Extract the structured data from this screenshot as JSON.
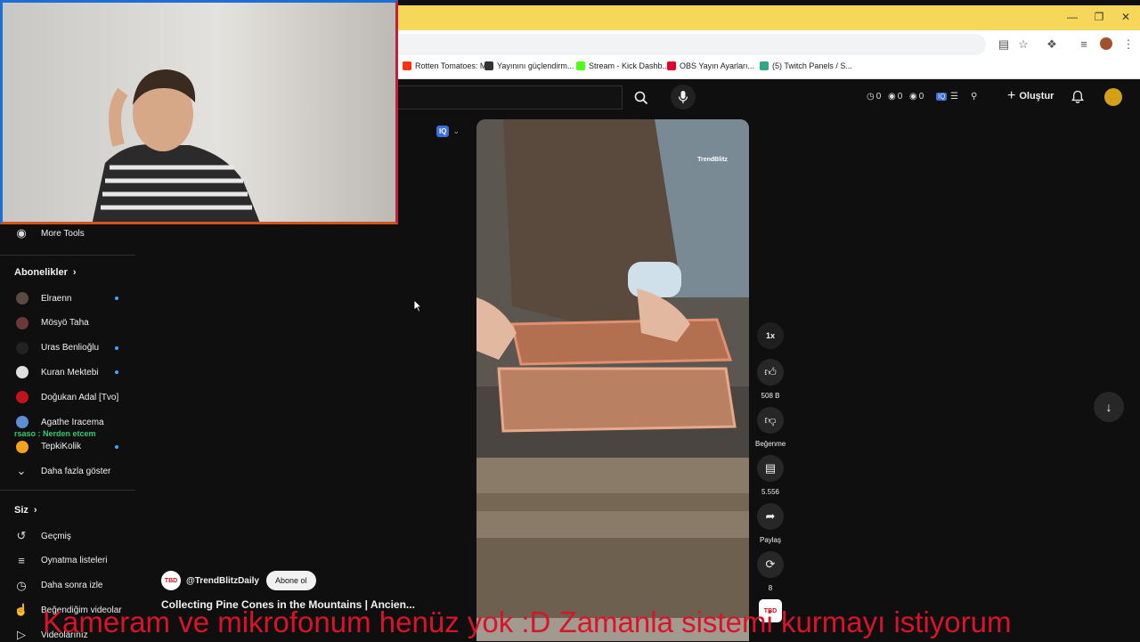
{
  "bookmarks": [
    {
      "label": "Rotten Tomatoes: M...",
      "color": "#fa320a"
    },
    {
      "label": "Yayınını güçlendirm...",
      "color": "#333333"
    },
    {
      "label": "Stream - Kick Dashb...",
      "color": "#53fc18"
    },
    {
      "label": "OBS Yayın Ayarları...",
      "color": "#e1002d"
    },
    {
      "label": "(5) Twitch Panels / S...",
      "color": "#2fa88a"
    }
  ],
  "header": {
    "ext_stats": [
      "0",
      "0",
      "0"
    ],
    "create_label": "Oluştur"
  },
  "sidebar": {
    "more_tools": "More Tools",
    "subscriptions_title": "Abonelikler",
    "channels": [
      {
        "name": "Elraenn",
        "color": "#5a4a40",
        "new": true
      },
      {
        "name": "Mösyö Taha",
        "color": "#6a3a3a",
        "new": false
      },
      {
        "name": "Uras Benlioğlu",
        "color": "#222222",
        "new": true
      },
      {
        "name": "Kuran Mektebi",
        "color": "#e0e0e0",
        "new": true
      },
      {
        "name": "Doğukan Adal [Tvo]",
        "color": "#c0141c",
        "new": false
      },
      {
        "name": "Agathe Iracema",
        "color": "#5a8fd6",
        "new": false
      },
      {
        "name": "TepkiKolik",
        "color": "#f2a31b",
        "new": true
      }
    ],
    "show_more": "Daha fazla göster",
    "you_title": "Siz",
    "you_items": [
      {
        "label": "Geçmiş",
        "icon": "history-icon"
      },
      {
        "label": "Oynatma listeleri",
        "icon": "playlist-icon"
      },
      {
        "label": "Daha sonra izle",
        "icon": "clock-icon"
      },
      {
        "label": "Beğendiğim videolar",
        "icon": "thumbs-up-icon"
      },
      {
        "label": "Videolarınız",
        "icon": "play-icon"
      }
    ]
  },
  "chat_overlay": "rsaso : Nerden etcem",
  "short": {
    "channel_handle": "@TrendBlitzDaily",
    "subscribe_label": "Abone ol",
    "title": "Collecting Pine Cones in the Mountains | Ancien...",
    "watermark": "TrendBlitz",
    "speed": "1x",
    "likes": "508 B",
    "dislike_label": "Beğenme",
    "comments": "5.556",
    "share_label": "Paylaş",
    "remix_count": "8",
    "avatar_text": "TBD"
  },
  "ext_badge": "IQ",
  "subtitle": "Kameram ve mikrofonum henüz yok :D Zamanla sistemi kurmayı istiyorum"
}
